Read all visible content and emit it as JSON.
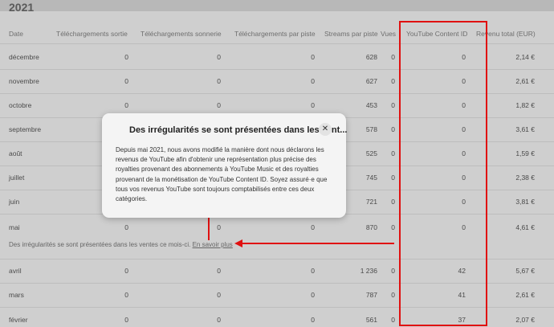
{
  "year": "2021",
  "headers": [
    "Date",
    "Téléchargements sortie",
    "Téléchargements sonnerie",
    "Téléchargements par piste",
    "Streams par piste",
    "Vues",
    "YouTube Content ID",
    "Revenu total (EUR)"
  ],
  "rows": [
    {
      "date": "décembre",
      "dl_out": "0",
      "dl_ring": "0",
      "dl_track": "0",
      "streams": "628",
      "views": "0",
      "ytcid": "0",
      "total": "2,14 €"
    },
    {
      "date": "novembre",
      "dl_out": "0",
      "dl_ring": "0",
      "dl_track": "0",
      "streams": "627",
      "views": "0",
      "ytcid": "0",
      "total": "2,61 €"
    },
    {
      "date": "octobre",
      "dl_out": "0",
      "dl_ring": "0",
      "dl_track": "0",
      "streams": "453",
      "views": "0",
      "ytcid": "0",
      "total": "1,82 €"
    },
    {
      "date": "septembre",
      "dl_out": "",
      "dl_ring": "",
      "dl_track": "",
      "streams": "578",
      "views": "0",
      "ytcid": "0",
      "total": "3,61 €"
    },
    {
      "date": "août",
      "dl_out": "",
      "dl_ring": "",
      "dl_track": "",
      "streams": "525",
      "views": "0",
      "ytcid": "0",
      "total": "1,59 €"
    },
    {
      "date": "juillet",
      "dl_out": "",
      "dl_ring": "",
      "dl_track": "",
      "streams": "745",
      "views": "0",
      "ytcid": "0",
      "total": "2,38 €"
    },
    {
      "date": "juin",
      "dl_out": "",
      "dl_ring": "",
      "dl_track": "",
      "streams": "721",
      "views": "0",
      "ytcid": "0",
      "total": "3,81 €"
    },
    {
      "date": "mai",
      "dl_out": "0",
      "dl_ring": "0",
      "dl_track": "0",
      "streams": "870",
      "views": "0",
      "ytcid": "0",
      "total": "4,61 €"
    },
    {
      "date": "avril",
      "dl_out": "0",
      "dl_ring": "0",
      "dl_track": "0",
      "streams": "1 236",
      "views": "0",
      "ytcid": "42",
      "total": "5,67 €"
    },
    {
      "date": "mars",
      "dl_out": "0",
      "dl_ring": "0",
      "dl_track": "0",
      "streams": "787",
      "views": "0",
      "ytcid": "41",
      "total": "2,61 €"
    },
    {
      "date": "février",
      "dl_out": "0",
      "dl_ring": "0",
      "dl_track": "0",
      "streams": "561",
      "views": "0",
      "ytcid": "37",
      "total": "2,07 €"
    }
  ],
  "notice": {
    "text": "Des irrégularités se sont présentées dans les ventes ce mois-ci.",
    "link": "En savoir plus"
  },
  "popup": {
    "title": "Des irrégularités se sont présentées dans les vent...",
    "close_icon": "close-icon",
    "body": "Depuis mai 2021, nous avons modifié la manière dont nous déclarons les revenus de YouTube afin d'obtenir une représentation plus précise des royalties provenant des abonnements à YouTube Music et des royalties provenant de la monétisation de YouTube Content ID. Soyez assuré·e que tous vos revenus YouTube sont toujours comptabilisés entre ces deux catégories."
  },
  "annotation_color": "#e01010"
}
